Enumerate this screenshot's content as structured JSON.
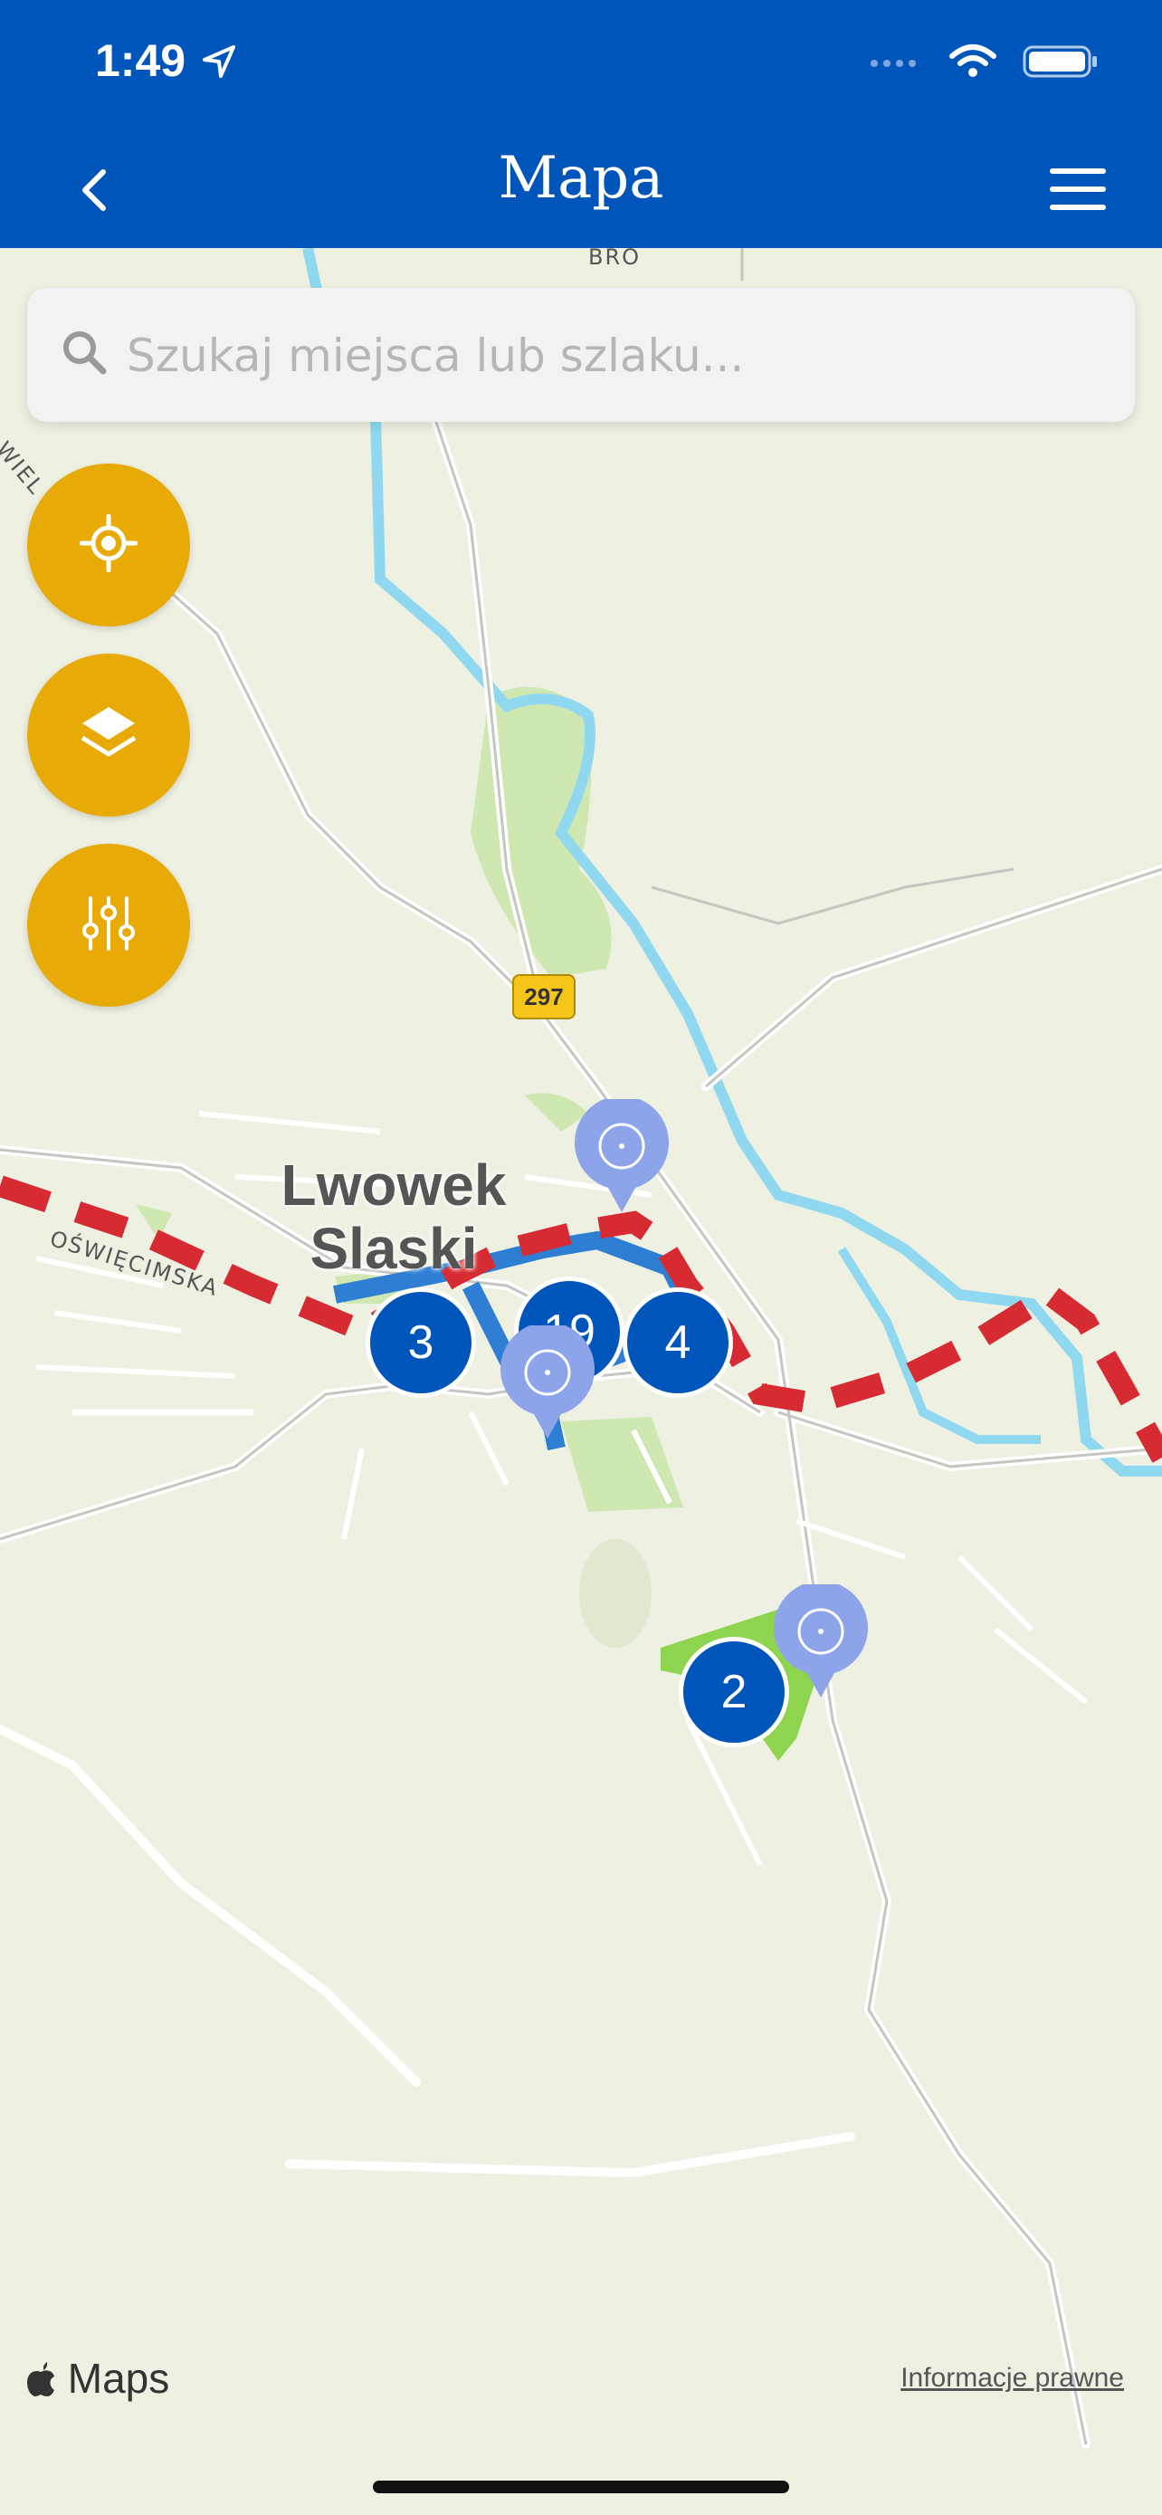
{
  "status": {
    "time": "1:49",
    "icons": [
      "location-arrow-icon",
      "signal-icon",
      "wifi-icon",
      "battery-icon"
    ]
  },
  "nav": {
    "title": "Mapa",
    "back_icon": "chevron-left-icon",
    "menu_icon": "hamburger-menu-icon"
  },
  "search": {
    "placeholder": "Szukaj miejsca lub szlaku..."
  },
  "controls": [
    {
      "name": "locate-button",
      "icon": "crosshair-icon"
    },
    {
      "name": "layers-button",
      "icon": "layers-icon"
    },
    {
      "name": "filters-button",
      "icon": "sliders-icon"
    }
  ],
  "map": {
    "town": "Lwowek\nSlaski",
    "town_line1": "Lwowek",
    "town_line2": "Slaski",
    "street_oswiecimska": "OŚWIĘCIMSKA",
    "street_top": "BRO",
    "street_left": "E WIEL",
    "road_badge": "297",
    "clusters": [
      "3",
      "19",
      "4",
      "2"
    ],
    "attribution": "Maps",
    "legal": "Informacje prawne"
  },
  "colors": {
    "brand_blue": "#0055bb",
    "accent_yellow": "#e8aa06",
    "trail_red": "#d62b33",
    "trail_blue": "#2e7fd4",
    "river": "#8fd8ef",
    "pin": "#8ea4ea"
  }
}
